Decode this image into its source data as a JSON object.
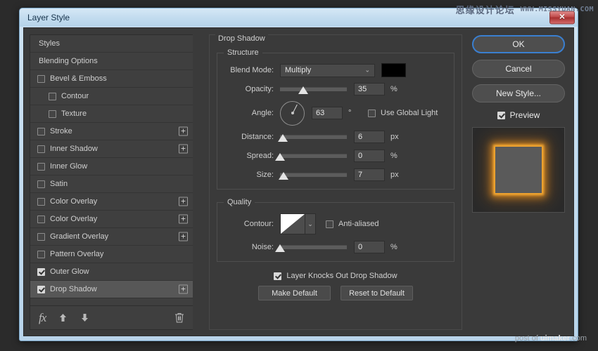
{
  "watermarks": {
    "top_cn": "思缘设计论坛",
    "top_url": "WWW.MISSYUAN.COM",
    "bottom_prefix": "post of ",
    "bottom_brand": "uimaker",
    "bottom_suffix": ".com"
  },
  "window": {
    "title": "Layer Style",
    "close_label": "✕"
  },
  "styles_panel": {
    "items": [
      {
        "label": "Styles",
        "type": "header",
        "checkbox": null,
        "plus": false
      },
      {
        "label": "Blending Options",
        "type": "header",
        "checkbox": null,
        "plus": false
      },
      {
        "label": "Bevel & Emboss",
        "type": "normal",
        "checkbox": false,
        "plus": false
      },
      {
        "label": "Contour",
        "type": "indent",
        "checkbox": false,
        "plus": false
      },
      {
        "label": "Texture",
        "type": "indent",
        "checkbox": false,
        "plus": false
      },
      {
        "label": "Stroke",
        "type": "normal",
        "checkbox": false,
        "plus": true
      },
      {
        "label": "Inner Shadow",
        "type": "normal",
        "checkbox": false,
        "plus": true
      },
      {
        "label": "Inner Glow",
        "type": "normal",
        "checkbox": false,
        "plus": false
      },
      {
        "label": "Satin",
        "type": "normal",
        "checkbox": false,
        "plus": false
      },
      {
        "label": "Color Overlay",
        "type": "normal",
        "checkbox": false,
        "plus": true
      },
      {
        "label": "Color Overlay",
        "type": "normal",
        "checkbox": false,
        "plus": true
      },
      {
        "label": "Gradient Overlay",
        "type": "normal",
        "checkbox": false,
        "plus": true
      },
      {
        "label": "Pattern Overlay",
        "type": "normal",
        "checkbox": false,
        "plus": false
      },
      {
        "label": "Outer Glow",
        "type": "normal",
        "checkbox": true,
        "plus": false
      },
      {
        "label": "Drop Shadow",
        "type": "selected",
        "checkbox": true,
        "plus": true
      }
    ],
    "toolbar": {
      "fx_label": "fx",
      "move_up_label": "▲",
      "move_down_label": "▼",
      "delete_label": "🗑"
    }
  },
  "effect": {
    "title": "Drop Shadow",
    "structure": {
      "legend": "Structure",
      "blend_mode_label": "Blend Mode:",
      "blend_mode_value": "Multiply",
      "blend_mode_caret": "⌄",
      "shadow_color": "#000000",
      "opacity_label": "Opacity:",
      "opacity_value": "35",
      "opacity_unit": "%",
      "opacity_percent": 35,
      "angle_label": "Angle:",
      "angle_value": "63",
      "angle_unit": "°",
      "angle_degrees": 63,
      "use_global_light_label": "Use Global Light",
      "use_global_light_checked": false,
      "distance_label": "Distance:",
      "distance_value": "6",
      "distance_unit": "px",
      "distance_percent": 4,
      "spread_label": "Spread:",
      "spread_value": "0",
      "spread_unit": "%",
      "spread_percent": 0,
      "size_label": "Size:",
      "size_value": "7",
      "size_unit": "px",
      "size_percent": 5
    },
    "quality": {
      "legend": "Quality",
      "contour_label": "Contour:",
      "contour_caret": "⌄",
      "anti_aliased_label": "Anti-aliased",
      "anti_aliased_checked": false,
      "noise_label": "Noise:",
      "noise_value": "0",
      "noise_unit": "%",
      "noise_percent": 0
    },
    "knockout_label": "Layer Knocks Out Drop Shadow",
    "knockout_checked": true,
    "make_default_label": "Make Default",
    "reset_default_label": "Reset to Default"
  },
  "actions": {
    "ok_label": "OK",
    "cancel_label": "Cancel",
    "new_style_label": "New Style...",
    "preview_label": "Preview",
    "preview_checked": true,
    "preview_glow_color": "#f0961f"
  }
}
